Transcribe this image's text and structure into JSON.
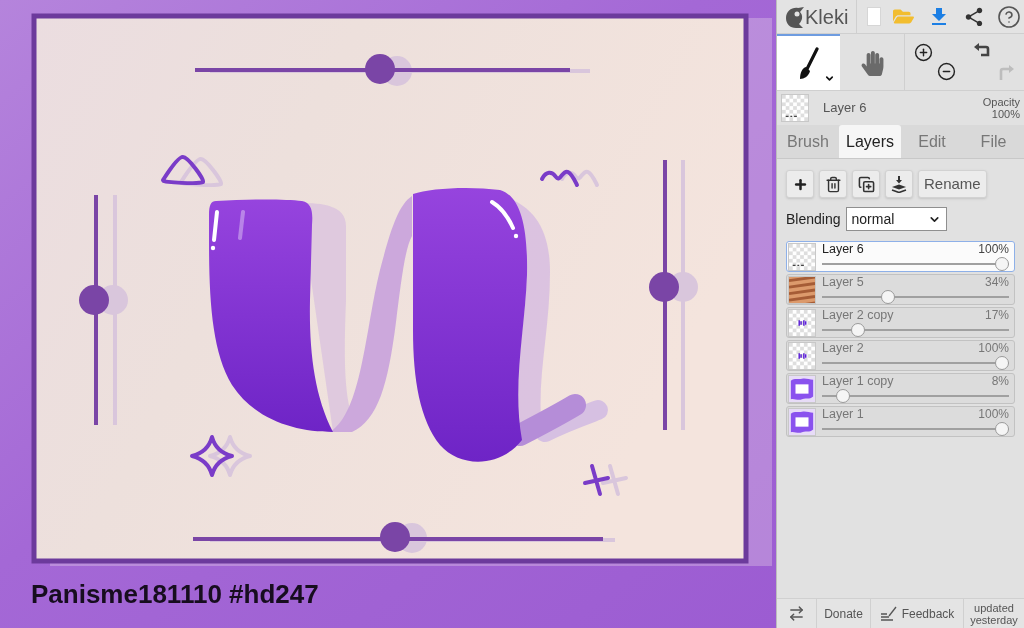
{
  "canvas": {
    "caption": "Panisme181110 #hd247"
  },
  "header": {
    "logo": "Kleki"
  },
  "tools": [
    {
      "kind": "brush",
      "selected": true
    },
    {
      "kind": "hand",
      "selected": false
    }
  ],
  "undo": {
    "disabled": false
  },
  "redo": {
    "disabled": true
  },
  "current_layer": {
    "kind": "blank",
    "name": "Layer 6",
    "opacity_label": "Opacity",
    "opacity": "100%"
  },
  "tabs": [
    {
      "label": "Brush",
      "selected": false
    },
    {
      "label": "Layers",
      "selected": true
    },
    {
      "label": "Edit",
      "selected": false
    },
    {
      "label": "File",
      "selected": false
    }
  ],
  "layer_panel": {
    "rename_button": "Rename",
    "blending_label": "Blending",
    "blending_value": "normal"
  },
  "layers": [
    {
      "kind": "blank",
      "name": "Layer 6",
      "opacity": "100%",
      "level": 1,
      "selected": true
    },
    {
      "kind": "wood",
      "name": "Layer 5",
      "opacity": "34%",
      "level": 0.34,
      "selected": false
    },
    {
      "kind": "marks",
      "name": "Layer 2 copy",
      "opacity": "17%",
      "level": 0.17,
      "selected": false
    },
    {
      "kind": "marks",
      "name": "Layer 2",
      "opacity": "100%",
      "level": 1,
      "selected": false
    },
    {
      "kind": "blob",
      "name": "Layer 1 copy",
      "opacity": "8%",
      "level": 0.08,
      "selected": false
    },
    {
      "kind": "blob",
      "name": "Layer 1",
      "opacity": "100%",
      "level": 1,
      "selected": false
    }
  ],
  "footer": {
    "donate": "Donate",
    "feedback": "Feedback",
    "update_note": "updated yesterday"
  }
}
